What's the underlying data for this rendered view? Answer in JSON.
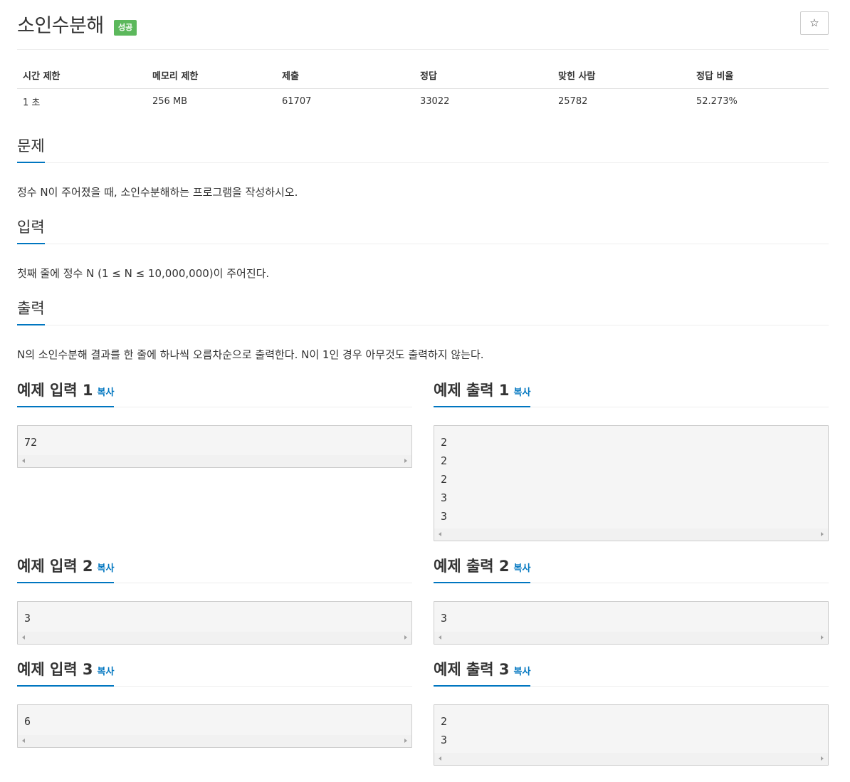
{
  "problem": {
    "title": "소인수분해",
    "status_badge": "성공",
    "star_icon": "☆"
  },
  "info_table": {
    "headers": [
      "시간 제한",
      "메모리 제한",
      "제출",
      "정답",
      "맞힌 사람",
      "정답 비율"
    ],
    "values": [
      "1 초",
      "256 MB",
      "61707",
      "33022",
      "25782",
      "52.273%"
    ]
  },
  "sections": {
    "problem_label": "문제",
    "problem_text": "정수 N이 주어졌을 때, 소인수분해하는 프로그램을 작성하시오.",
    "input_label": "입력",
    "input_text": "첫째 줄에 정수 N (1 ≤ N ≤ 10,000,000)이 주어진다.",
    "output_label": "출력",
    "output_text": "N의 소인수분해 결과를 한 줄에 하나씩 오름차순으로 출력한다. N이 1인 경우 아무것도 출력하지 않는다."
  },
  "copy_label": "복사",
  "samples": [
    {
      "input_title": "예제 입력 1",
      "input": "72",
      "output_title": "예제 출력 1",
      "output": "2\n2\n2\n3\n3"
    },
    {
      "input_title": "예제 입력 2",
      "input": "3",
      "output_title": "예제 출력 2",
      "output": "3"
    },
    {
      "input_title": "예제 입력 3",
      "input": "6",
      "output_title": "예제 출력 3",
      "output": "2\n3"
    }
  ],
  "colors": {
    "accent": "#0076c0",
    "success": "#5cb85c"
  }
}
